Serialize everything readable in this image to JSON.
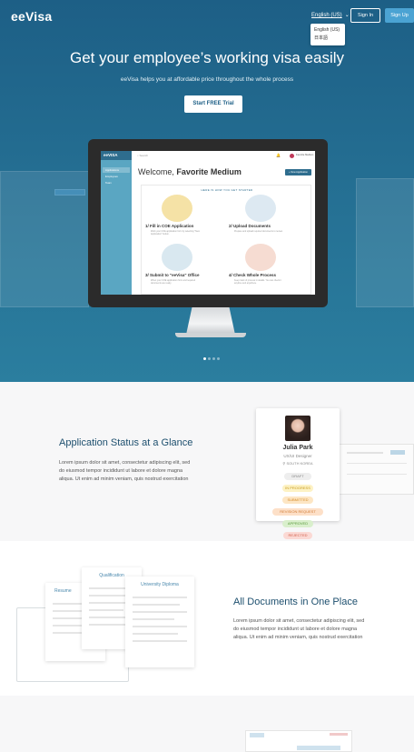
{
  "header": {
    "logo": "eeVisa",
    "language": "English (US)",
    "language_options": [
      "English (US)",
      "日本語"
    ],
    "sign_in": "Sign In",
    "sign_up": "Sign Up"
  },
  "hero": {
    "title": "Get your employee’s working visa easily",
    "subtitle": "eeVisa helps you at affordable price throughout the whole process",
    "cta": "Start FREE Trial"
  },
  "app_preview": {
    "logo": "eeVISA",
    "search_placeholder": "Search",
    "user_name": "Favorite Medium",
    "nav": [
      "Applications",
      "Employees",
      "Team"
    ],
    "welcome_prefix": "Welcome,",
    "welcome_name": "Favorite Medium",
    "new_application": "+ New Application",
    "steps_heading": "HERE IS HOW YOU GET STARTED",
    "steps": [
      {
        "num": "1",
        "title": "Fill in COE Application",
        "text": "Work your COE application form by selecting \"New Application\" button."
      },
      {
        "num": "2",
        "title": "Upload Documents",
        "text": "Prepare and upload required documents to review."
      },
      {
        "num": "3",
        "title": "Submit to \"eeVisa\" Office",
        "text": "When your COE application form and required documents are ready."
      },
      {
        "num": "4",
        "title": "Check Whole Process",
        "text": "Keep track of process in details. You can check it anytime and anywhere."
      }
    ],
    "carousel_active": 1
  },
  "status_section": {
    "title": "Application Status at a Glance",
    "body": [
      "Lorem ipsum dolor sit amet, consectetur adipiscing elit, sed",
      "do eiusmod tempor incididunt ut labore et dolore magna",
      "aliqua. Ut enim ad minim veniam, quis nostrud exercitation"
    ],
    "profile": {
      "name": "Julia Park",
      "role": "UX/UI Designer",
      "location": "SOUTH KOREA"
    },
    "statuses": [
      {
        "label": "DRAFT",
        "bg": "#eeeeee",
        "fg": "#888888"
      },
      {
        "label": "IN PROGRESS",
        "bg": "#fdf2c4",
        "fg": "#c79a1e"
      },
      {
        "label": "SUBMITTED",
        "bg": "#fde6c4",
        "fg": "#d48b2a"
      },
      {
        "label": "REVISION REQUEST",
        "bg": "#fde0c8",
        "fg": "#d07b35"
      },
      {
        "label": "APPROVED",
        "bg": "#d9efcc",
        "fg": "#5a9a3c"
      },
      {
        "label": "REJECTED",
        "bg": "#fbd9d4",
        "fg": "#d0604c"
      }
    ]
  },
  "documents_section": {
    "title": "All Documents in One Place",
    "body": [
      "Lorem ipsum dolor sit amet, consectetur adipiscing elit, sed",
      "do eiusmod tempor incididunt ut labore et dolore magna",
      "aliqua. Ut enim ad minim veniam, quis nostrud exercitation"
    ],
    "docs": [
      "Resume",
      "Qualification",
      "University Diploma"
    ]
  }
}
